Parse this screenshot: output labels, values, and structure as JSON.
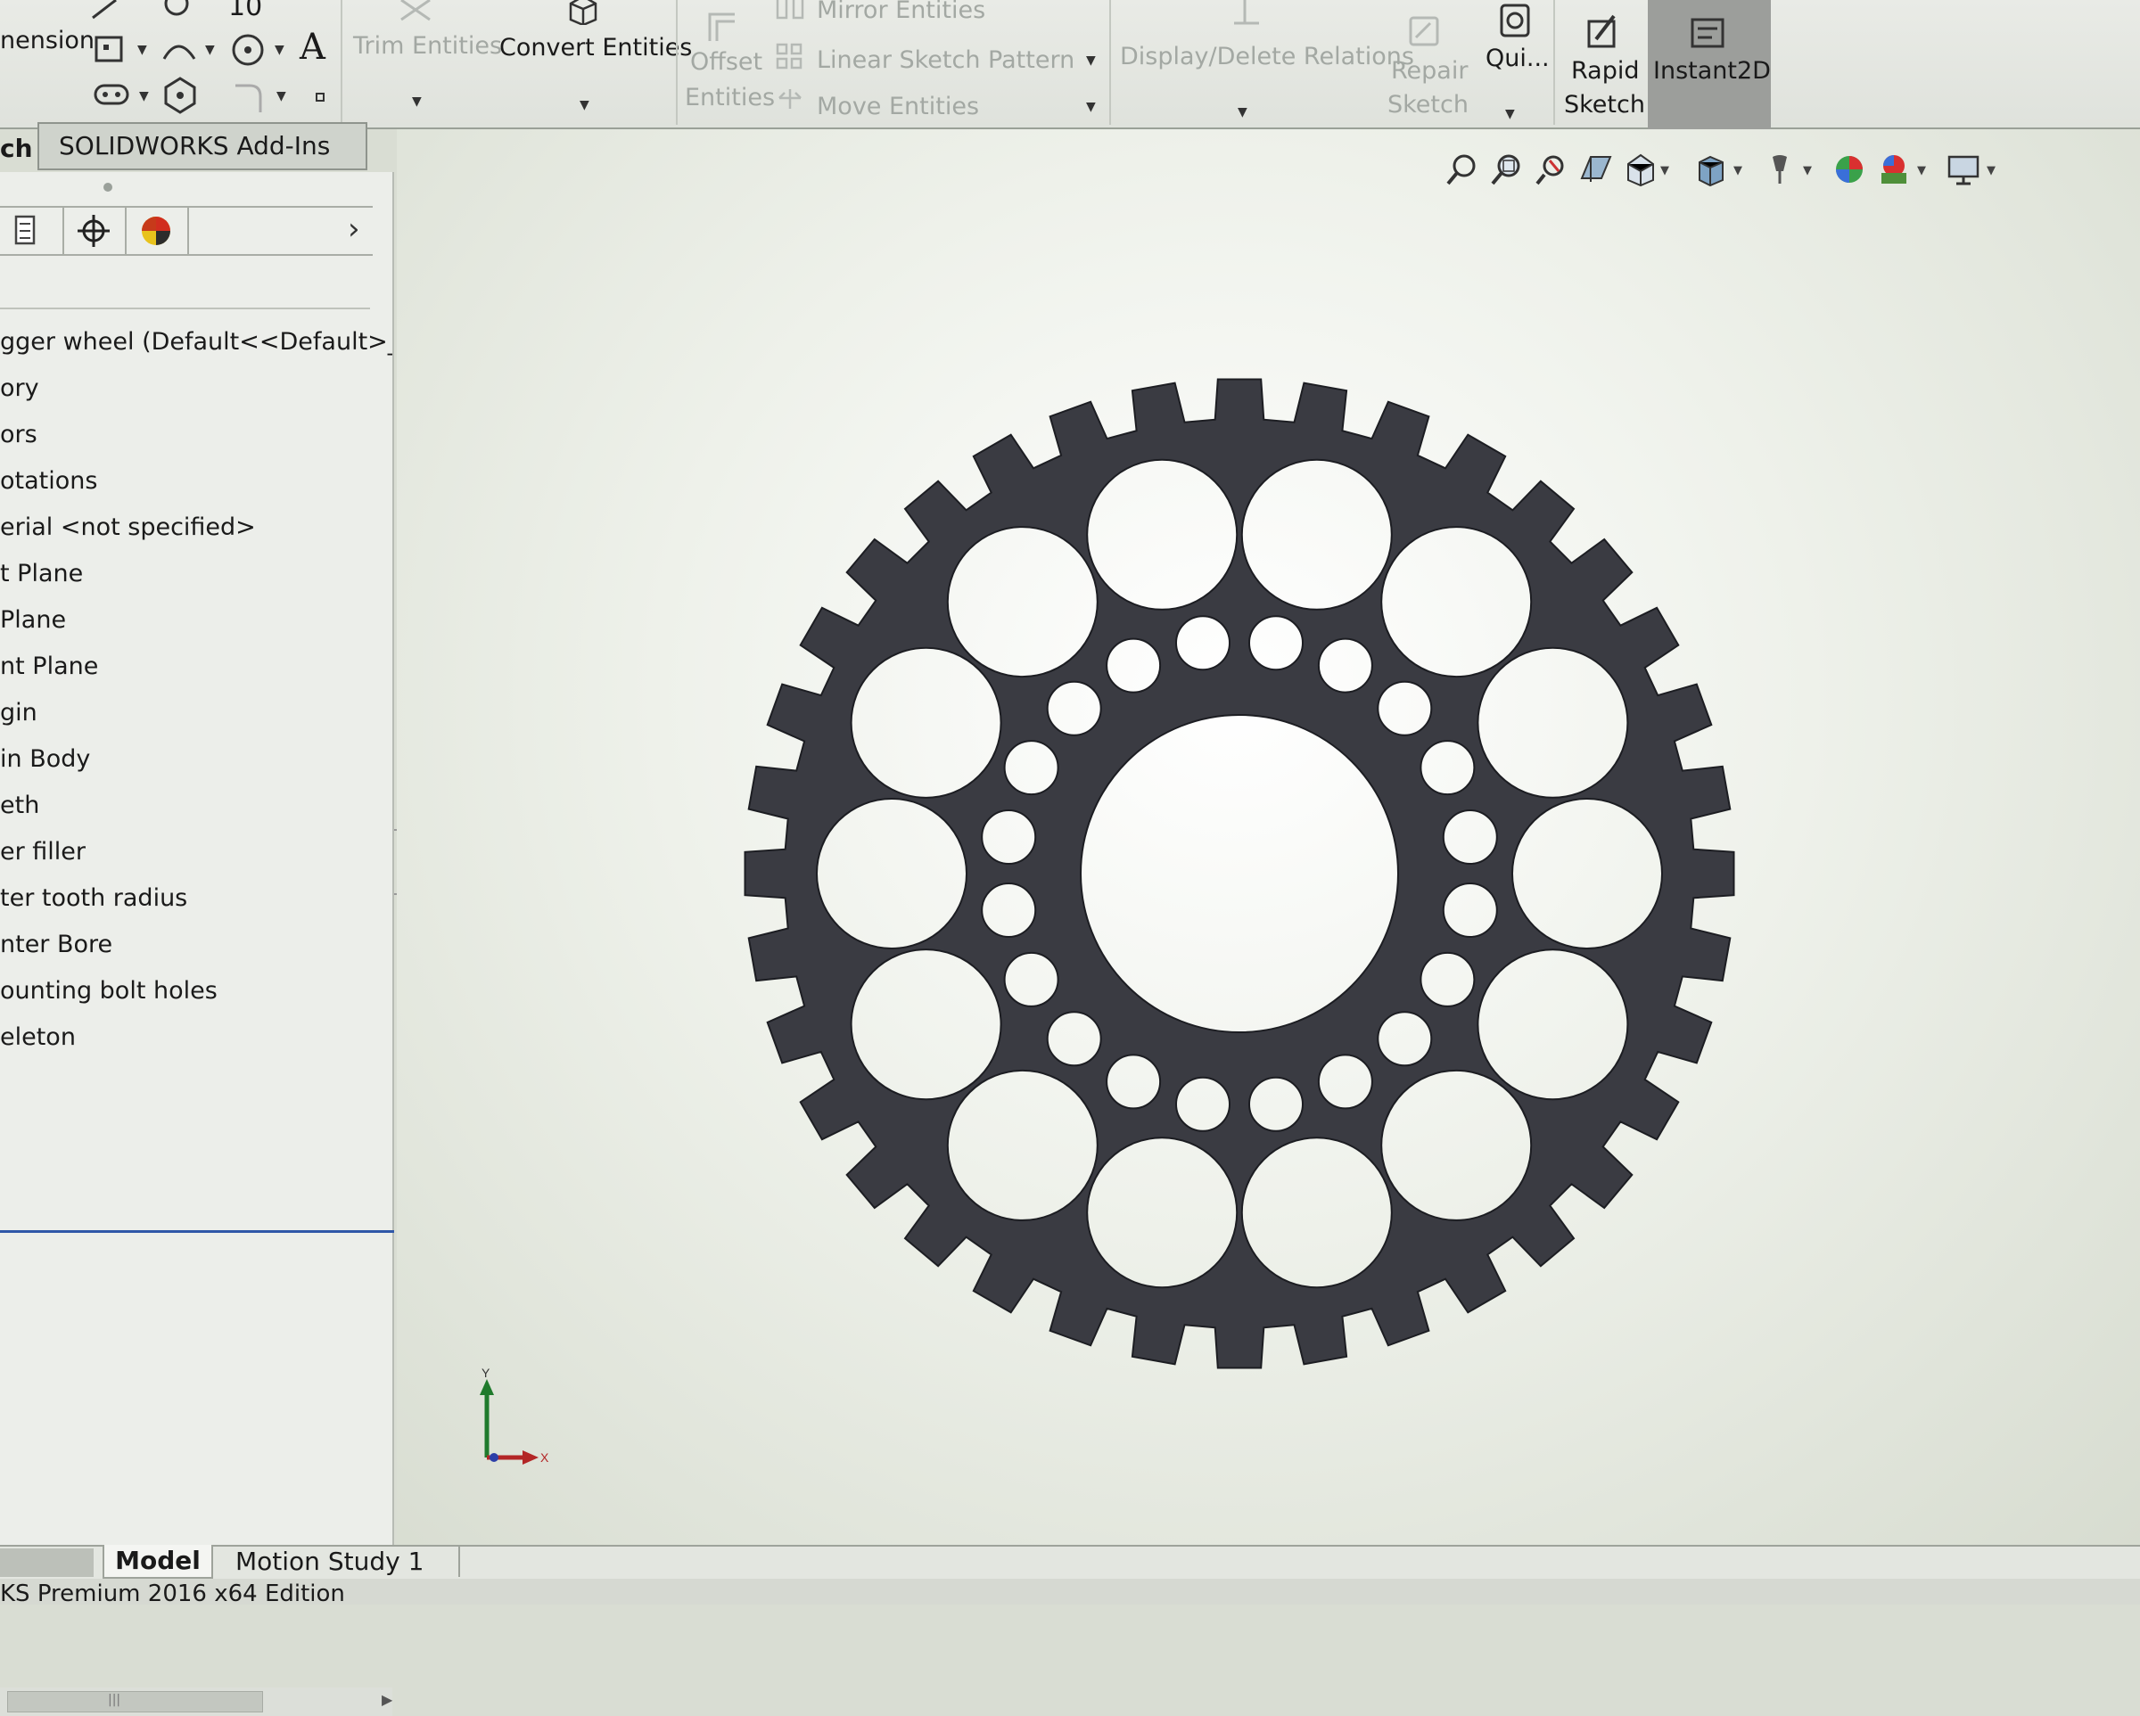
{
  "ribbon": {
    "dimension_label": "nension",
    "trim_entities": "Trim Entities",
    "convert_entities": "Convert Entities",
    "offset_entities_line1": "Offset",
    "offset_entities_line2": "Entities",
    "mirror_entities": "Mirror Entities",
    "linear_sketch_pattern": "Linear Sketch Pattern",
    "move_entities": "Move Entities",
    "display_delete_relations": "Display/Delete Relations",
    "repair_sketch_line1": "Repair",
    "repair_sketch_line2": "Sketch",
    "quick_snaps": "Qui...",
    "rapid_sketch_line1": "Rapid",
    "rapid_sketch_line2": "Sketch",
    "instant2d": "Instant2D",
    "text_tool_glyph": "A",
    "sketch_number_glyph": "10"
  },
  "command_tabs": {
    "sketch_tab": "ch",
    "addins_tab": "SOLIDWORKS Add-Ins"
  },
  "feature_tree": {
    "items": [
      "gger wheel  (Default<<Default>_[",
      "ory",
      "ors",
      "otations",
      "erial <not specified>",
      "t Plane",
      " Plane",
      "nt Plane",
      "gin",
      "in Body",
      "eth",
      "er filler",
      "ter tooth radius",
      "nter Bore",
      "ounting bolt holes",
      "eleton"
    ]
  },
  "bottom_tabs": {
    "model": "Model",
    "motion_study": "Motion Study 1"
  },
  "status_bar": {
    "edition": "KS Premium 2016 x64 Edition"
  },
  "triad": {
    "x_label": "X",
    "y_label": "Y"
  },
  "colors": {
    "part": "#3a3b42",
    "accent_selection": "#2f57a8",
    "ribbon_active": "#9c9e9b"
  },
  "part": {
    "tooth_count": 36,
    "outer_hole_count": 14,
    "inner_hole_count": 20
  }
}
